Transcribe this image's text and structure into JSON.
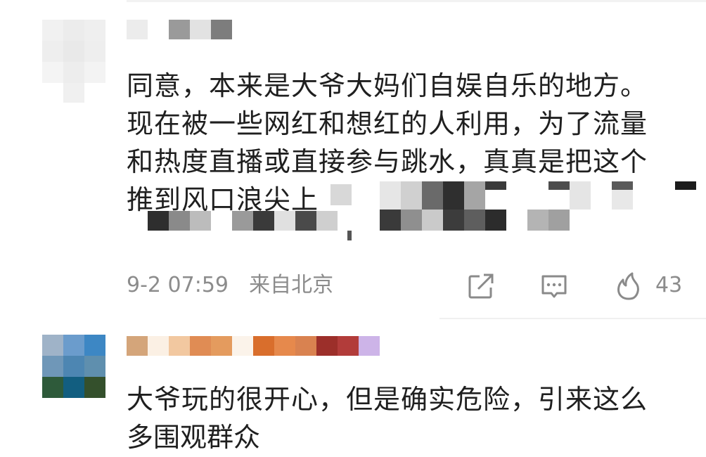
{
  "comments": [
    {
      "text_lines": [
        "同意，本来是大爷大妈们自娱自乐的地方。",
        "现在被一些网红和想红的人利用，为了流量",
        "和热度直播或直接参与跳水，真真是把这个",
        "推到风口浪尖上"
      ],
      "timestamp": "9-2 07:59",
      "location": "来自北京",
      "likes": "43"
    },
    {
      "text_lines": [
        "大爷玩的很开心，但是确实危险，引来这么",
        "多围观群众"
      ]
    }
  ],
  "icons": {
    "share": "share-icon",
    "comment": "comment-icon",
    "like": "flame-like-icon"
  },
  "colors": {
    "text": "#1f1f1f",
    "meta": "#8c8c8c"
  }
}
